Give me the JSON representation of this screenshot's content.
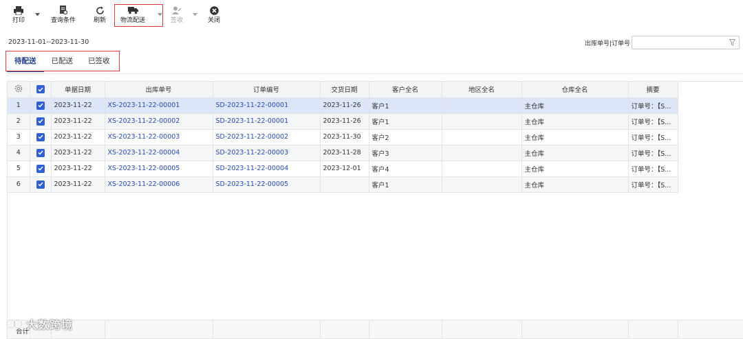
{
  "toolbar": {
    "print": "打印",
    "query": "查询条件",
    "refresh": "刷新",
    "logistics": "物流配送",
    "sign": "签收",
    "close": "关闭"
  },
  "date_range": "2023-11-01--2023-11-30",
  "search": {
    "label": "出库单号|订单号",
    "value": ""
  },
  "tabs": [
    {
      "label": "待配送",
      "active": true
    },
    {
      "label": "已配送",
      "active": false
    },
    {
      "label": "已签收",
      "active": false
    }
  ],
  "table": {
    "columns": [
      "单据日期",
      "出库单号",
      "订单编号",
      "交货日期",
      "客户全名",
      "地区全名",
      "仓库全名",
      "摘要"
    ],
    "rows": [
      [
        "1",
        "2023-11-22",
        "XS-2023-11-22-00001",
        "SD-2023-11-22-00001",
        "2023-11-26",
        "客户1",
        "",
        "主仓库",
        "订单号：【S..."
      ],
      [
        "2",
        "2023-11-22",
        "XS-2023-11-22-00002",
        "SD-2023-11-22-00001",
        "2023-11-26",
        "客户1",
        "",
        "主仓库",
        "订单号：【S..."
      ],
      [
        "3",
        "2023-11-22",
        "XS-2023-11-22-00003",
        "SD-2023-11-22-00002",
        "2023-11-30",
        "客户2",
        "",
        "主仓库",
        "订单号：【S..."
      ],
      [
        "4",
        "2023-11-22",
        "XS-2023-11-22-00004",
        "SD-2023-11-22-00003",
        "2023-11-28",
        "客户3",
        "",
        "主仓库",
        "订单号：【S..."
      ],
      [
        "5",
        "2023-11-22",
        "XS-2023-11-22-00005",
        "SD-2023-11-22-00004",
        "2023-12-01",
        "客户4",
        "",
        "主仓库",
        "订单号：【S..."
      ],
      [
        "6",
        "2023-11-22",
        "XS-2023-11-22-00006",
        "SD-2023-11-22-00005",
        "",
        "客户1",
        "",
        "主仓库",
        "订单号：【S..."
      ]
    ],
    "footer_label": "合计"
  },
  "watermark": "大数跨境",
  "colors": {
    "accent": "#2f5fd0",
    "highlight": "#e0383e",
    "link": "#2649b5",
    "selected_row": "#dce6f8"
  }
}
